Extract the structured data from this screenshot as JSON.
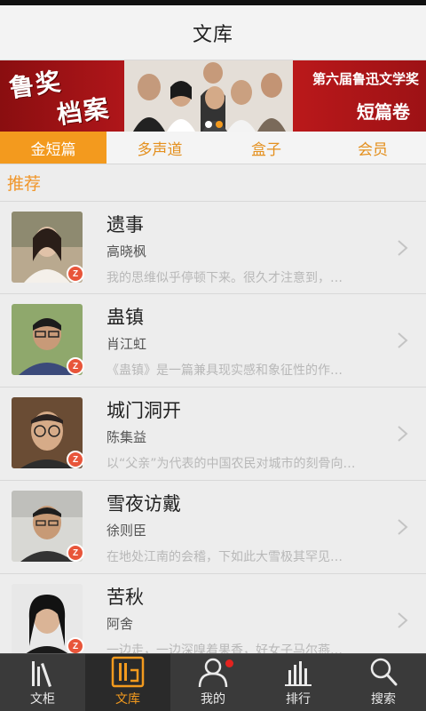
{
  "app": {
    "title": "文库"
  },
  "banner": {
    "logo_line1": "鲁奖",
    "logo_line2": "档案",
    "subtitle_line1": "第六届鲁迅文学奖",
    "subtitle_line2": "短篇卷",
    "page_count": 2,
    "active_page": 1
  },
  "tabs": [
    {
      "label": "金短篇",
      "active": true
    },
    {
      "label": "多声道",
      "active": false
    },
    {
      "label": "盒子",
      "active": false
    },
    {
      "label": "会员",
      "active": false
    }
  ],
  "section_label": "推荐",
  "items": [
    {
      "title": "遗事",
      "author": "高晓枫",
      "desc": "我的思维似乎停顿下来。很久才注意到，…",
      "badge": "Z"
    },
    {
      "title": "蛊镇",
      "author": "肖江虹",
      "desc": "《蛊镇》是一篇兼具现实感和象征性的作…",
      "badge": "Z"
    },
    {
      "title": "城门洞开",
      "author": "陈集益",
      "desc": "以“父亲”为代表的中国农民对城市的刻骨向…",
      "badge": "Z"
    },
    {
      "title": "雪夜访戴",
      "author": "徐则臣",
      "desc": "在地处江南的会稽，下如此大雪极其罕见…",
      "badge": "Z"
    },
    {
      "title": "苦秋",
      "author": "阿舍",
      "desc": "一边走，一边深嗅着果香，好女子马尔燕…",
      "badge": "Z"
    }
  ],
  "tabbar": [
    {
      "label": "文柜",
      "icon": "bookshelf-icon",
      "active": false
    },
    {
      "label": "文库",
      "icon": "library-icon",
      "active": true
    },
    {
      "label": "我的",
      "icon": "user-icon",
      "active": false,
      "notification": true
    },
    {
      "label": "排行",
      "icon": "ranking-icon",
      "active": false
    },
    {
      "label": "搜索",
      "icon": "search-icon",
      "active": false
    }
  ],
  "colors": {
    "accent": "#f39a1e",
    "banner": "#b0161a",
    "badge": "#e8553a",
    "tabbar": "#3a3a3a"
  }
}
